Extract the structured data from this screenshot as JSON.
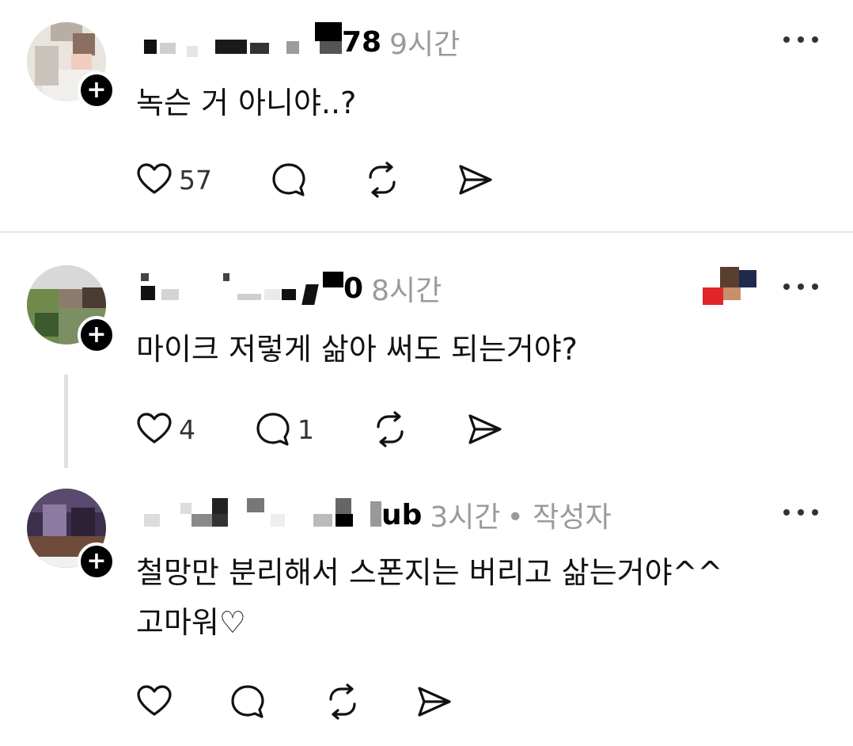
{
  "posts": [
    {
      "username_visible_tail": "78",
      "time": "9시간",
      "author_badge": "",
      "text": [
        "녹슨 거 아니야..?"
      ],
      "likes": "57",
      "replies": "",
      "icons": [
        "heart-icon",
        "comment-icon",
        "repost-icon",
        "share-icon",
        "more-icon",
        "plus-icon"
      ]
    },
    {
      "username_visible_tail": "0",
      "time": "8시간",
      "author_badge": "",
      "text": [
        "마이크 저렇게 삶아 써도 되는거야?"
      ],
      "likes": "4",
      "replies": "1",
      "icons": [
        "heart-icon",
        "comment-icon",
        "repost-icon",
        "share-icon",
        "more-icon",
        "plus-icon"
      ]
    },
    {
      "username_visible_tail": "ub",
      "time": "3시간",
      "author_badge": "• 작성자",
      "text": [
        "철망만 분리해서 스폰지는 버리고 삶는거야^^",
        "고마워♡"
      ],
      "likes": "",
      "replies": "",
      "icons": [
        "heart-icon",
        "comment-icon",
        "repost-icon",
        "share-icon",
        "more-icon",
        "plus-icon"
      ]
    }
  ],
  "colors": {
    "muted": "#9a9a9a",
    "text": "#111111",
    "divider": "#e6e6e6"
  }
}
